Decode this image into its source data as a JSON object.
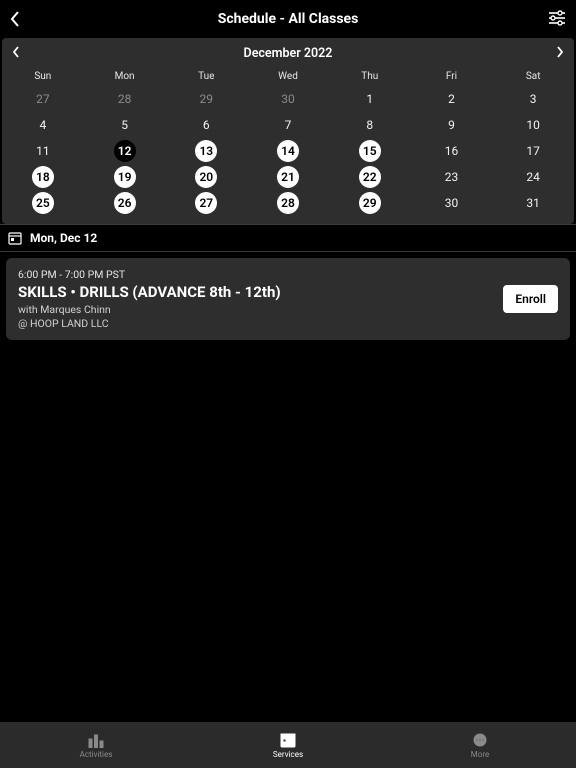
{
  "header": {
    "title": "Schedule - All Classes"
  },
  "calendar": {
    "month_label": "December 2022",
    "dow": [
      "Sun",
      "Mon",
      "Tue",
      "Wed",
      "Thu",
      "Fri",
      "Sat"
    ],
    "weeks": [
      [
        {
          "d": "27",
          "s": "dim"
        },
        {
          "d": "28",
          "s": "dim"
        },
        {
          "d": "29",
          "s": "dim"
        },
        {
          "d": "30",
          "s": "dim"
        },
        {
          "d": "1",
          "s": "normal"
        },
        {
          "d": "2",
          "s": "normal"
        },
        {
          "d": "3",
          "s": "normal"
        }
      ],
      [
        {
          "d": "4",
          "s": "normal"
        },
        {
          "d": "5",
          "s": "normal"
        },
        {
          "d": "6",
          "s": "normal"
        },
        {
          "d": "7",
          "s": "normal"
        },
        {
          "d": "8",
          "s": "normal"
        },
        {
          "d": "9",
          "s": "normal"
        },
        {
          "d": "10",
          "s": "normal"
        }
      ],
      [
        {
          "d": "11",
          "s": "normal"
        },
        {
          "d": "12",
          "s": "selected"
        },
        {
          "d": "13",
          "s": "avail"
        },
        {
          "d": "14",
          "s": "avail"
        },
        {
          "d": "15",
          "s": "avail"
        },
        {
          "d": "16",
          "s": "normal"
        },
        {
          "d": "17",
          "s": "normal"
        }
      ],
      [
        {
          "d": "18",
          "s": "avail"
        },
        {
          "d": "19",
          "s": "avail"
        },
        {
          "d": "20",
          "s": "avail"
        },
        {
          "d": "21",
          "s": "avail"
        },
        {
          "d": "22",
          "s": "avail"
        },
        {
          "d": "23",
          "s": "normal"
        },
        {
          "d": "24",
          "s": "normal"
        }
      ],
      [
        {
          "d": "25",
          "s": "avail"
        },
        {
          "d": "26",
          "s": "avail"
        },
        {
          "d": "27",
          "s": "avail"
        },
        {
          "d": "28",
          "s": "avail"
        },
        {
          "d": "29",
          "s": "avail"
        },
        {
          "d": "30",
          "s": "normal"
        },
        {
          "d": "31",
          "s": "normal"
        }
      ]
    ]
  },
  "selected_date": {
    "label": "Mon, Dec 12"
  },
  "class": {
    "time": "6:00 PM - 7:00 PM PST",
    "title": "SKILLS •  DRILLS (ADVANCE 8th - 12th)",
    "instructor": "with Marques Chinn",
    "location": "@ HOOP LAND LLC",
    "enroll_label": "Enroll"
  },
  "tabs": {
    "activities": "Activities",
    "services": "Services",
    "more": "More"
  }
}
